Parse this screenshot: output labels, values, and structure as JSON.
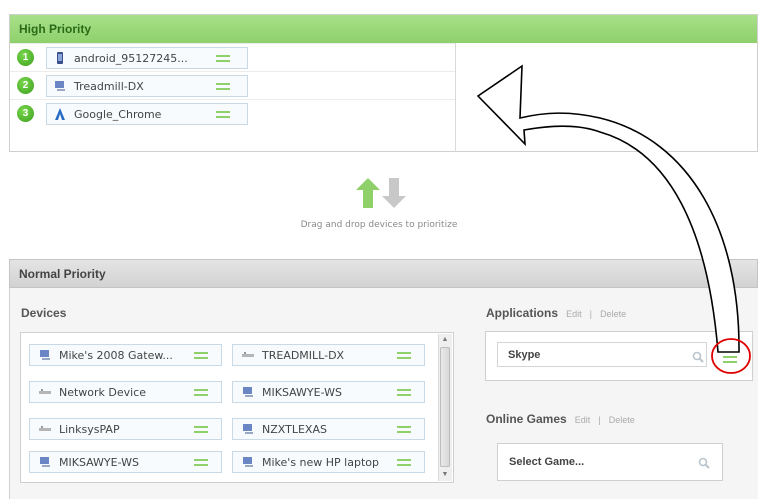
{
  "high_priority": {
    "title": "High Priority",
    "items": [
      {
        "number": "1",
        "name": "android_95127245...",
        "icon": "phone-icon"
      },
      {
        "number": "2",
        "name": "Treadmill-DX",
        "icon": "computer-icon"
      },
      {
        "number": "3",
        "name": "Google_Chrome",
        "icon": "app-icon"
      }
    ]
  },
  "drag_hint": "Drag and drop devices to prioritize",
  "normal_priority": {
    "title": "Normal Priority",
    "devices_label": "Devices",
    "devices": [
      {
        "name": "Mike's 2008 Gatew...",
        "icon": "computer-icon"
      },
      {
        "name": "TREADMILL-DX",
        "icon": "network-device-icon"
      },
      {
        "name": "Network Device",
        "icon": "network-device-icon"
      },
      {
        "name": "MIKSAWYE-WS",
        "icon": "computer-icon"
      },
      {
        "name": "LinksysPAP",
        "icon": "network-device-icon"
      },
      {
        "name": "NZXTLEXAS",
        "icon": "computer-icon"
      },
      {
        "name": "MIKSAWYE-WS",
        "icon": "computer-icon"
      },
      {
        "name": "Mike's new HP laptop",
        "icon": "computer-icon"
      }
    ],
    "applications": {
      "label": "Applications",
      "edit": "Edit",
      "separator": "|",
      "delete": "Delete",
      "value": "Skype"
    },
    "online_games": {
      "label": "Online Games",
      "edit": "Edit",
      "separator": "|",
      "delete": "Delete",
      "placeholder": "Select Game..."
    }
  },
  "colors": {
    "green_accent": "#8fd06b",
    "highlight_circle": "#e00000"
  }
}
